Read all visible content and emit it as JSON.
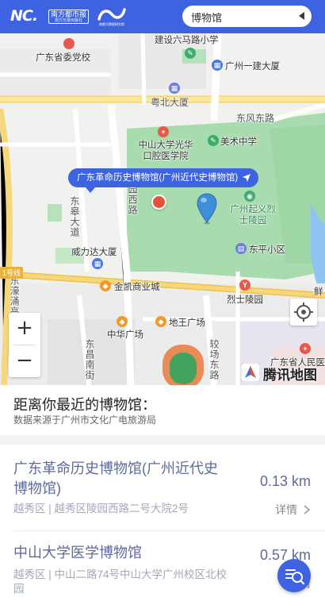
{
  "header": {
    "logo_nc": "NC.",
    "logo_nfrb": "南方都市报",
    "logo_nfrb_sub": "南方日报出版社",
    "logo_lab_text": "南都大数据研究院",
    "search": {
      "value": "博物馆",
      "icon": "caret-left-icon"
    }
  },
  "map": {
    "roads": {
      "dongfeng": "东风东路",
      "yuexiu_north": "粤北大厦",
      "yuanxi": "园西路",
      "dongxiao": "东皋大道",
      "donghao": "东濠涌高架",
      "dongchang": "东昌南街",
      "jiaochang": "较场东路",
      "metro_line": "1号线"
    },
    "labels": {
      "party_school": "广东省委党校",
      "liuma": "建设六马路小学",
      "yijian": "广州一建大厦",
      "dental": "中山大学光华口腔医学院",
      "art_school": "美术中学",
      "martyrs_park": "广州起义烈士陵园",
      "weilida": "威力达大厦",
      "dongping": "东平小区",
      "jinkai": "金凯商业城",
      "martyrs_station": "烈士陵园",
      "zhonghua": "中华广场",
      "diwang": "地王广场",
      "peoples": "广东省人民医院",
      "xian": "鲜"
    },
    "tooltip": "广东革命历史博物馆(广州近代史博物馆)",
    "controls": {
      "zoom_in": "+",
      "zoom_out": "−"
    },
    "brand": "腾讯地图"
  },
  "info": {
    "title": "距离你最近的博物馆：",
    "source": "数据来源于广州市文化广电旅游局"
  },
  "museums": [
    {
      "name": "广东革命历史博物馆(广州近代史博物馆)",
      "distance": "0.13 km",
      "address": "越秀区 | 越秀区陵园西路二号大院2号",
      "detail": "详情"
    },
    {
      "name": "中山大学医学博物馆",
      "distance": "0.57 km",
      "address": "越秀区 | 中山二路74号中山大学广州校区北校园",
      "detail": "详情"
    }
  ],
  "colors": {
    "brand_blue": "#3d63e0",
    "list_title": "#5e6b9a",
    "park_green": "#a8dcae",
    "metro_yellow": "#f4c24a"
  },
  "icons": {
    "fab": "search-list-icon",
    "locate": "locate-icon",
    "pin": "map-pin-icon"
  }
}
